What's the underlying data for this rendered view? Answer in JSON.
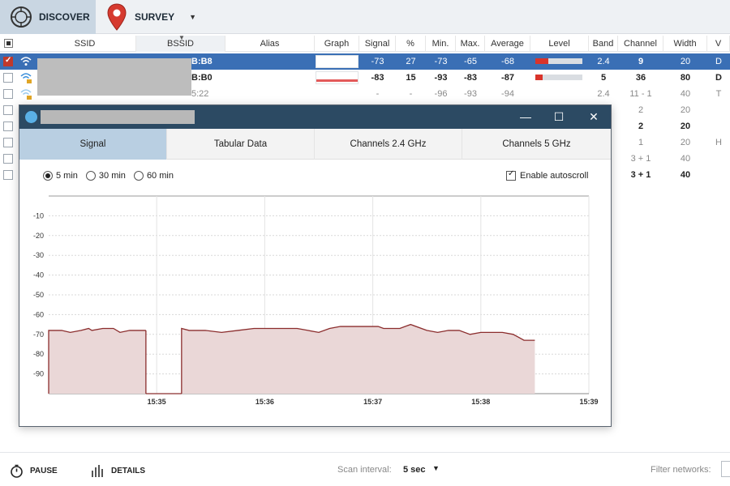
{
  "toolbar": {
    "discover_label": "DISCOVER",
    "survey_label": "SURVEY"
  },
  "table": {
    "columns": [
      "SSID",
      "BSSID",
      "Alias",
      "Graph",
      "Signal",
      "%",
      "Min.",
      "Max.",
      "Average",
      "Level",
      "Band",
      "Channel",
      "Width",
      "V"
    ],
    "rows": [
      {
        "bssid_suffix": "B:B8",
        "signal": "-73",
        "pct": "27",
        "min": "-73",
        "max": "-65",
        "avg": "-68",
        "level": 0.27,
        "band": "2.4",
        "channel": "9",
        "width": "20",
        "v": "D",
        "selected": true,
        "checked": true,
        "bold": true
      },
      {
        "bssid_suffix": "B:B0",
        "signal": "-83",
        "pct": "15",
        "min": "-93",
        "max": "-83",
        "avg": "-87",
        "level": 0.15,
        "band": "5",
        "channel": "36",
        "width": "80",
        "v": "D",
        "selected": false,
        "checked": false,
        "bold": true
      },
      {
        "bssid_suffix": "5:22",
        "signal": "-",
        "pct": "-",
        "min": "-96",
        "max": "-93",
        "avg": "-94",
        "level": 0,
        "band": "2.4",
        "channel": "11 - 1",
        "width": "40",
        "v": "T",
        "selected": false,
        "checked": false,
        "bold": false
      },
      {
        "channel": "2",
        "width": "20",
        "bold": false
      },
      {
        "channel": "2",
        "width": "20",
        "bold": true
      },
      {
        "channel": "1",
        "width": "20",
        "v": "H",
        "bold": false
      },
      {
        "channel": "3 + 1",
        "width": "40",
        "bold": false
      },
      {
        "channel": "3 + 1",
        "width": "40",
        "bold": true
      }
    ]
  },
  "dialog": {
    "tabs": [
      "Signal",
      "Tabular Data",
      "Channels 2.4 GHz",
      "Channels 5 GHz"
    ],
    "active_tab": "Signal",
    "time_options": [
      "5 min",
      "30 min",
      "60 min"
    ],
    "selected_time": "5 min",
    "autoscroll_label": "Enable autoscroll",
    "autoscroll_checked": true,
    "minimize": "—",
    "maximize": "☐",
    "close": "✕"
  },
  "chart_data": {
    "type": "area",
    "title": "",
    "xlabel": "",
    "ylabel": "",
    "y_ticks": [
      -10,
      -20,
      -30,
      -40,
      -50,
      -60,
      -70,
      -80,
      -90
    ],
    "x_ticks": [
      "15:35",
      "15:36",
      "15:37",
      "15:38",
      "15:39"
    ],
    "ylim": [
      -100,
      0
    ],
    "grid": true,
    "color": "#8b2d2d",
    "fill": "#ead7d7",
    "segments": [
      [
        [
          0,
          -68
        ],
        [
          0.12,
          -68
        ],
        [
          0.2,
          -69
        ],
        [
          0.3,
          -68
        ],
        [
          0.37,
          -67
        ],
        [
          0.4,
          -68
        ],
        [
          0.5,
          -67
        ],
        [
          0.6,
          -67
        ],
        [
          0.66,
          -69
        ],
        [
          0.75,
          -68
        ],
        [
          0.9,
          -68
        ]
      ],
      [
        [
          1.23,
          -67
        ],
        [
          1.3,
          -68
        ],
        [
          1.45,
          -68
        ],
        [
          1.6,
          -69
        ],
        [
          1.75,
          -68
        ],
        [
          1.9,
          -67
        ],
        [
          2.1,
          -67
        ],
        [
          2.3,
          -67
        ],
        [
          2.4,
          -68
        ],
        [
          2.5,
          -69
        ],
        [
          2.6,
          -67
        ],
        [
          2.7,
          -66
        ],
        [
          2.85,
          -66
        ],
        [
          3.05,
          -66
        ],
        [
          3.1,
          -67
        ],
        [
          3.25,
          -67
        ],
        [
          3.3,
          -66
        ],
        [
          3.35,
          -65
        ],
        [
          3.5,
          -68
        ],
        [
          3.6,
          -69
        ],
        [
          3.7,
          -68
        ],
        [
          3.8,
          -68
        ],
        [
          3.9,
          -70
        ],
        [
          4.0,
          -69
        ],
        [
          4.1,
          -69
        ],
        [
          4.2,
          -69
        ],
        [
          4.3,
          -70
        ],
        [
          4.4,
          -73
        ],
        [
          4.5,
          -73
        ]
      ]
    ]
  },
  "bottom": {
    "pause_label": "PAUSE",
    "details_label": "DETAILS",
    "scan_label": "Scan interval:",
    "scan_value": "5 sec",
    "filter_label": "Filter networks:"
  }
}
